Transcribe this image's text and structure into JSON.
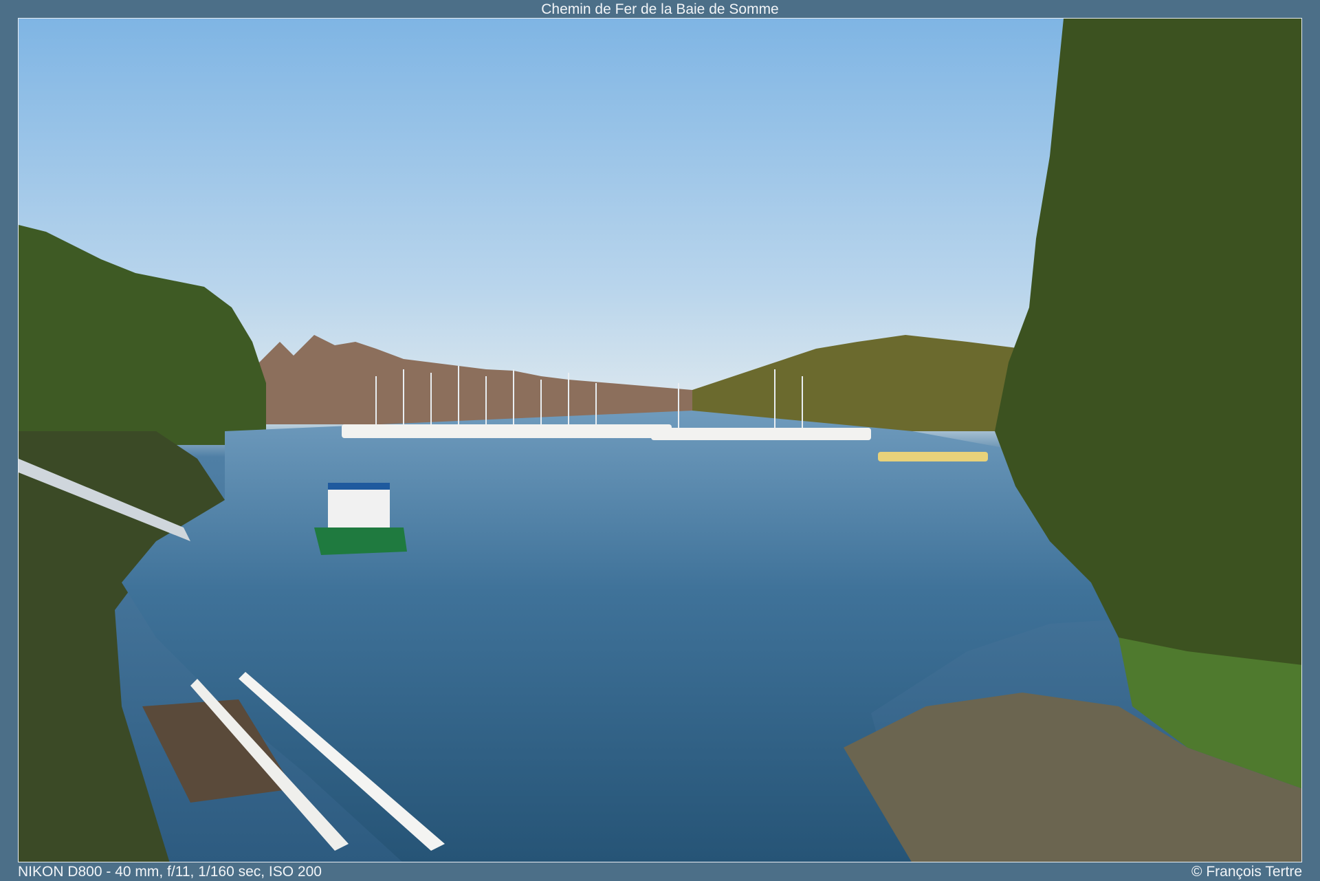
{
  "header": {
    "title": "Chemin de Fer de la Baie de Somme"
  },
  "photo": {
    "subject": "harbour-scene",
    "colors": {
      "sky": "#9cc6ea",
      "water": "#3a6d94",
      "foliage": "#3e5a24",
      "frame": "#4c6f88"
    }
  },
  "footer": {
    "exif": "NIKON D800 - 40 mm, f/11, 1/160 sec, ISO 200",
    "credit": "© François Tertre"
  }
}
